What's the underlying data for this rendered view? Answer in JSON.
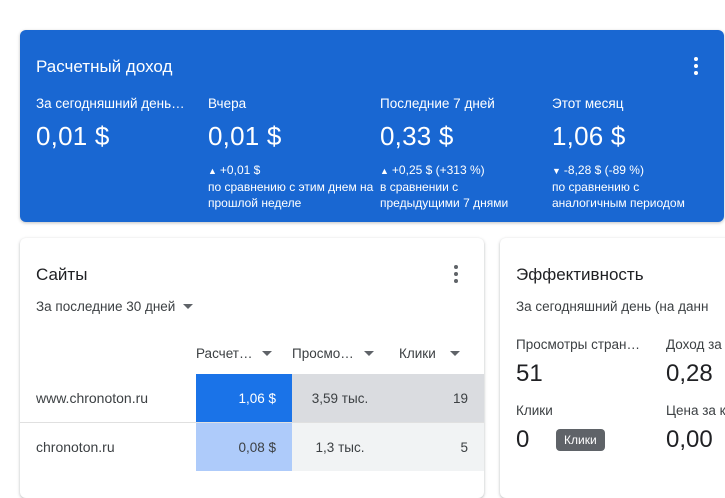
{
  "earnings": {
    "title": "Расчетный доход",
    "periods": [
      {
        "label": "За сегодняшний день…",
        "value": "0,01 $",
        "change": "",
        "compare": ""
      },
      {
        "label": "Вчера",
        "value": "0,01 $",
        "arrow": "▲",
        "change": "+0,01 $",
        "compare": "по сравнению с этим днем на прошлой неделе"
      },
      {
        "label": "Последние 7 дней",
        "value": "0,33 $",
        "arrow": "▲",
        "change": "+0,25 $ (+313 %)",
        "compare": "в сравнении с предыдущими 7 днями"
      },
      {
        "label": "Этот месяц",
        "value": "1,06 $",
        "arrow": "▼",
        "change": "-8,28 $ (-89 %)",
        "compare": "по сравнению с аналогичным периодом"
      }
    ]
  },
  "sites": {
    "title": "Сайты",
    "range": "За последние 30 дней",
    "columns": [
      "Расчет…",
      "Просмо…",
      "Клики"
    ],
    "rows": [
      {
        "site": "www.chronoton.ru",
        "earnings": "1,06 $",
        "views": "3,59 тыс.",
        "clicks": "19"
      },
      {
        "site": "chronoton.ru",
        "earnings": "0,08 $",
        "views": "1,3 тыс.",
        "clicks": "5"
      }
    ]
  },
  "performance": {
    "title": "Эффективность",
    "subtitle": "За сегодняшний день (на данн",
    "metrics": [
      {
        "label": "Просмотры стран…",
        "value": "51"
      },
      {
        "label": "Доход за",
        "value": "0,28"
      },
      {
        "label": "Клики",
        "value": "0"
      },
      {
        "label": "Цена за к",
        "value": "0,00"
      }
    ],
    "tooltip": "Клики"
  },
  "colors": {
    "accent": "#1967d2",
    "heat_high": "#1a73e8",
    "heat_low": "#aecbfa"
  }
}
